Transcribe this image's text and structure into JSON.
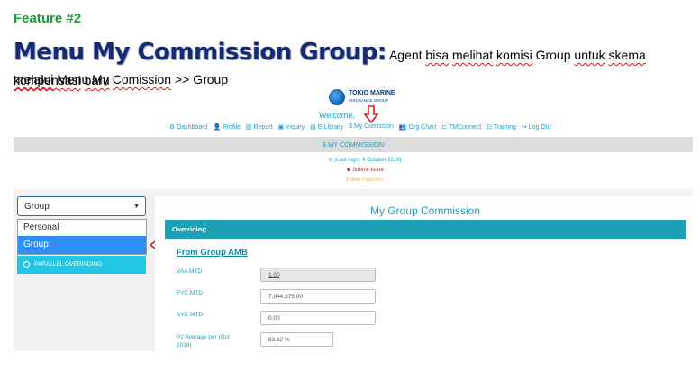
{
  "feature_label": "Feature #2",
  "headline": {
    "title": "Menu My Commission Group:",
    "desc_1": " Agent ",
    "desc_bisa": "bisa",
    "desc_2": " ",
    "desc_melihat": "melihat",
    "desc_3": " ",
    "desc_komisi": "komisi",
    "desc_4": " Group ",
    "desc_untuk": "untuk",
    "desc_5": " ",
    "desc_skema": "skema",
    "desc_6": " ",
    "desc_kompensasi": "kompensasi",
    "desc_7": " ",
    "desc_baru": "baru",
    "line2_melalui": "melalui",
    "line2_rest1": " Menu My ",
    "line2_comission": "Comission",
    "line2_rest2": " >> Group"
  },
  "app": {
    "logo_line1": "TOKIO MARINE",
    "logo_line2": "INSURANCE GROUP",
    "welcome": "Welcome,",
    "nav": [
      {
        "icon": "gear-icon",
        "label": "⚙ Dashboard"
      },
      {
        "icon": "user-icon",
        "label": "👤 Profile"
      },
      {
        "icon": "chart-icon",
        "label": "▥ Report"
      },
      {
        "icon": "briefcase-icon",
        "label": "▣ Inquiry"
      },
      {
        "icon": "book-icon",
        "label": "▤ E-Library"
      },
      {
        "icon": "dollar-icon",
        "label": "$ My Comission"
      },
      {
        "icon": "users-icon",
        "label": "👥 Org Chart"
      },
      {
        "icon": "link-icon",
        "label": "⊏ TMConnect"
      },
      {
        "icon": "training-icon",
        "label": "⊡ Training"
      },
      {
        "icon": "logout-icon",
        "label": "↪ Log Out"
      }
    ],
    "commission_bar": "$  MY COMMISSION",
    "last_login": "⊙ (Last login: 4 October 2018)",
    "submit_issue": "♞ Submit Issue",
    "new_features": "ℹ New Features",
    "select_value": "Group",
    "options": [
      "Personal",
      "Group"
    ],
    "parallel_label": "PARALLEL OVERRIDING",
    "page_title": "My Group Commission",
    "section_title": "Overriding",
    "sub_title": "From Group AMB",
    "fields": [
      {
        "label": "VAA MTD",
        "value": "1.00"
      },
      {
        "label": "FYC MTD",
        "value": "7,944,375.00"
      },
      {
        "label": "SYC MTD",
        "value": "0.00"
      },
      {
        "label": "P2 Average per (Oct 2018)",
        "value": "83.62 %"
      }
    ]
  },
  "colors": {
    "feature_green": "#1f9a3a",
    "title_navy": "#1a2a6e",
    "accent_teal": "#1a9fbf",
    "header_teal": "#1da1b5",
    "selected_blue": "#2d8ef5",
    "parallel_cyan": "#22c7e6",
    "arrow_red": "#d32020"
  }
}
